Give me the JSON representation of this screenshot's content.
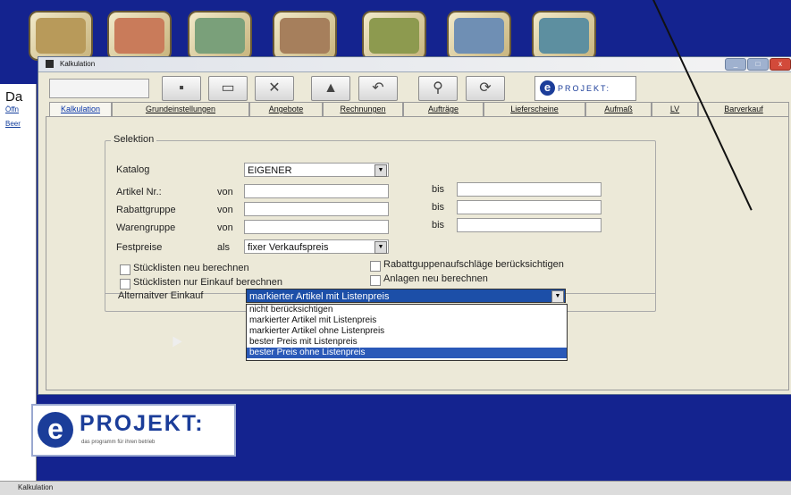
{
  "window": {
    "title": "Kalkulation",
    "min_label": "_",
    "max_label": "□",
    "close_label": "x"
  },
  "left_panel": {
    "title": "Da",
    "links": [
      "Öffn",
      "Beer"
    ]
  },
  "toolbar": {
    "brand_letter": "e",
    "brand_text": "PROJEKT:"
  },
  "tabs": [
    "Kalkulation",
    "Grundeinstellungen",
    "Angebote",
    "Rechnungen",
    "Aufträge",
    "Lieferscheine",
    "Aufmaß",
    "LV",
    "Barverkauf"
  ],
  "selektion": {
    "legend": "Selektion",
    "katalog_label": "Katalog",
    "katalog_value": "EIGENER",
    "artikel_label": "Artikel Nr.:",
    "rabatt_label": "Rabattgruppe",
    "waren_label": "Warengruppe",
    "von": "von",
    "bis": "bis",
    "festpreise_label": "Festpreise",
    "als": "als",
    "festpreise_value": "fixer Verkaufspreis",
    "cb_stueck_neu": "Stücklisten neu berechnen",
    "cb_stueck_einkauf": "Stücklisten nur Einkauf berechnen",
    "cb_rabatt": "Rabattguppenaufschläge berücksichtigen",
    "cb_anlagen": "Anlagen neu berechnen"
  },
  "alternativ": {
    "label": "Alternaitver Einkauf",
    "value": "markierter Artikel mit Listenpreis",
    "options": [
      "nicht berücksichtigen",
      "markierter Artikel mit Listenpreis",
      "markierter Artikel ohne Listenpreis",
      "bester Preis mit Listenpreis",
      "bester Preis ohne Listenpreis"
    ],
    "highlighted_index": 4
  },
  "logo": {
    "letter": "e",
    "word": "PROJEKT:",
    "tagline": "das programm für ihren betrieb"
  },
  "status_bar": {
    "text": "Kalkulation"
  },
  "colors": {
    "desktop": "#14238f",
    "accent": "#1b3d99",
    "selection": "#2a59b8"
  }
}
